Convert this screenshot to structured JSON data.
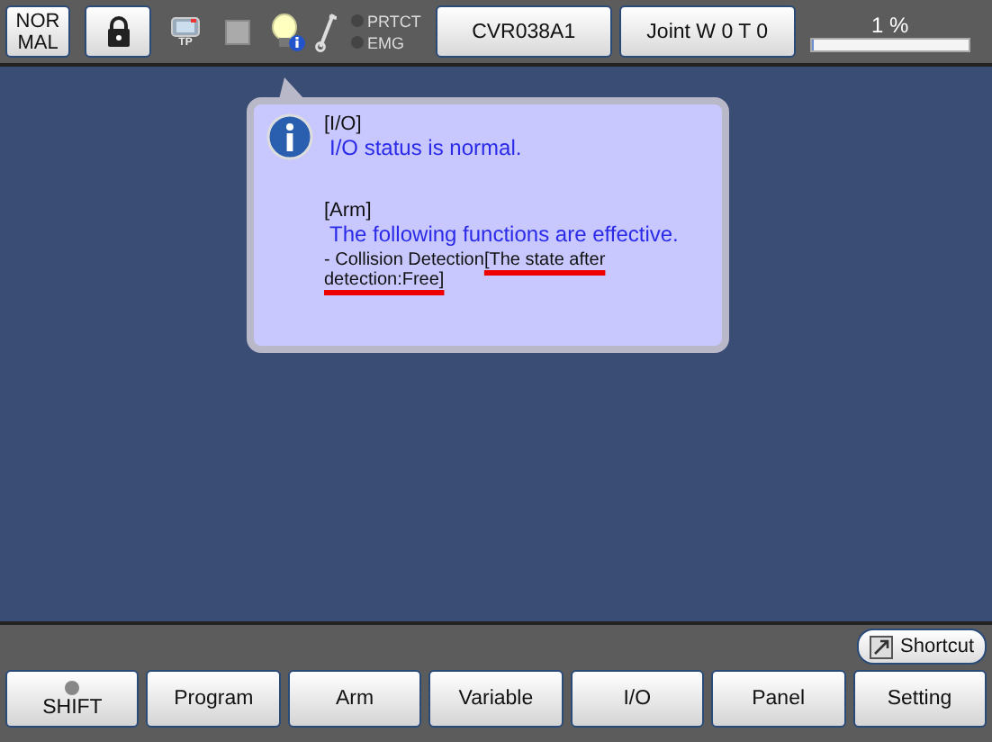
{
  "top_bar": {
    "mode_button": "NOR MAL",
    "tp_label": "TP",
    "indicators": [
      {
        "label": "PRTCT",
        "on": false
      },
      {
        "label": "EMG",
        "on": false
      }
    ],
    "program_button": "CVR038A1",
    "joint_button": "Joint  W 0 T 0",
    "speed": {
      "reading": "1 %",
      "level": 0.01
    }
  },
  "popup": {
    "sections": [
      {
        "header": "[I/O]",
        "message": "I/O status is normal."
      },
      {
        "header": "[Arm]",
        "message": "The following functions are effective.",
        "detail": "- Collision Detection",
        "detail_highlight": "[The state after detection:Free]"
      }
    ]
  },
  "shortcut_button": "Shortcut",
  "bottom_buttons": [
    {
      "label": "SHIFT",
      "kind": "shift",
      "lamp_on": false
    },
    {
      "label": "Program",
      "kind": "plain"
    },
    {
      "label": "Arm",
      "kind": "plain"
    },
    {
      "label": "Variable",
      "kind": "plain"
    },
    {
      "label": "I/O",
      "kind": "plain"
    },
    {
      "label": "Panel",
      "kind": "plain"
    },
    {
      "label": "Setting",
      "kind": "plain"
    }
  ]
}
